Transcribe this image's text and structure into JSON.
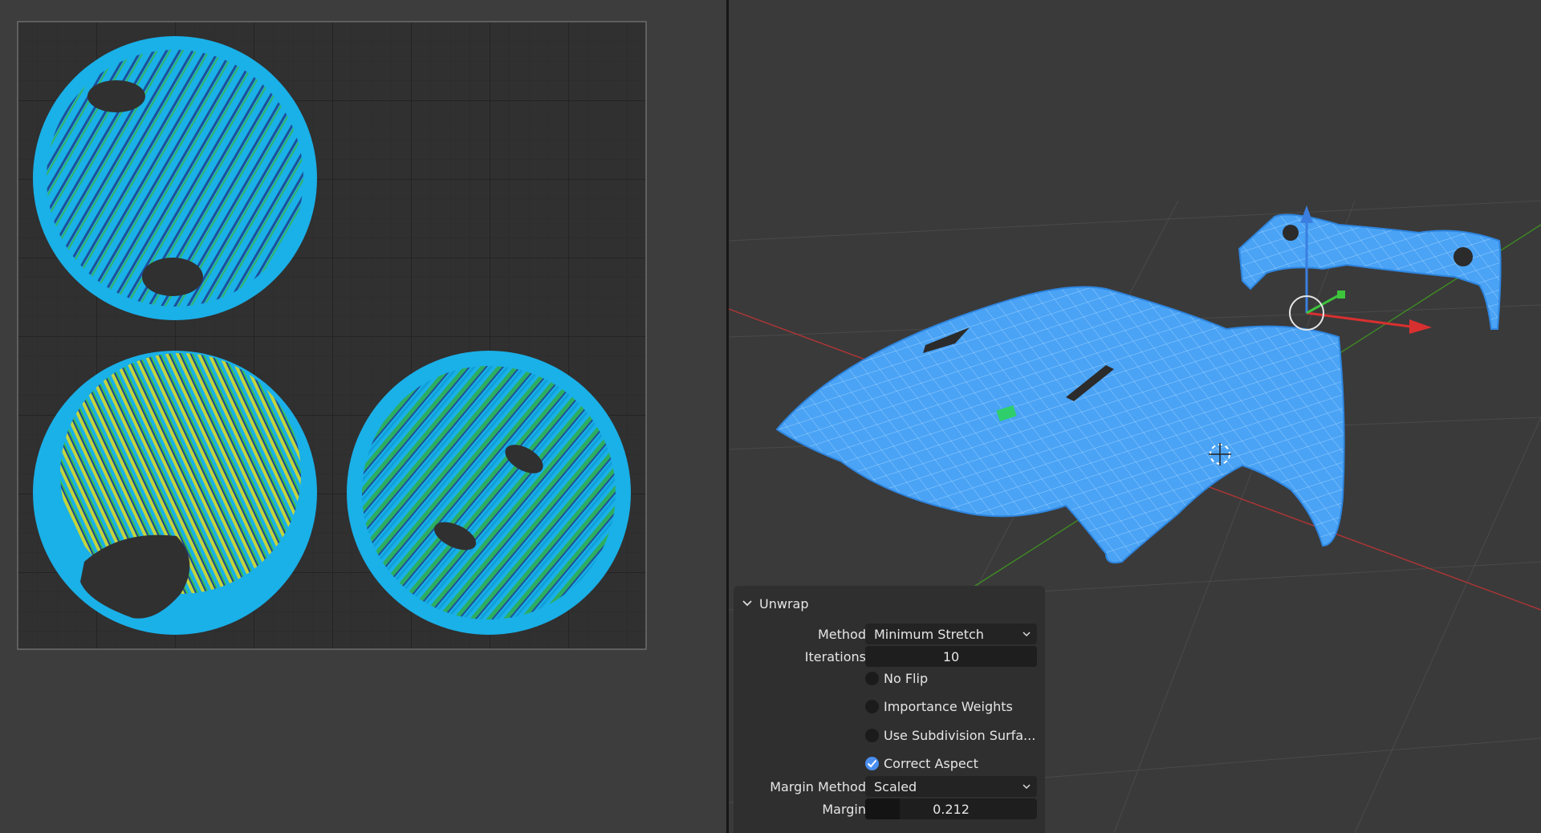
{
  "uv_editor": {
    "islands": [
      {
        "name": "uv-island-top-left"
      },
      {
        "name": "uv-island-bottom-left"
      },
      {
        "name": "uv-island-bottom-right"
      }
    ]
  },
  "viewport": {
    "mesh": "car body parts (hood, fender, rear bumper) with UV stretch overlay",
    "colors": {
      "mesh": "#4aa3f5",
      "x_axis": "#c83232",
      "y_axis": "#4a9a2a",
      "z_axis": "#3a7fe0"
    }
  },
  "operator_panel": {
    "title": "Unwrap",
    "method": {
      "label": "Method",
      "value": "Minimum Stretch"
    },
    "iterations": {
      "label": "Iterations",
      "value": "10"
    },
    "no_flip": {
      "label": "No Flip",
      "checked": false
    },
    "importance_weights": {
      "label": "Importance Weights",
      "checked": false
    },
    "use_subdivision": {
      "label": "Use Subdivision Surfa...",
      "checked": false
    },
    "correct_aspect": {
      "label": "Correct Aspect",
      "checked": true
    },
    "margin_method": {
      "label": "Margin Method",
      "value": "Scaled"
    },
    "margin": {
      "label": "Margin",
      "value": "0.212"
    }
  },
  "colors": {
    "accent": "#4a8ef0",
    "uv_fill": "#1ab0e8",
    "stretch_low": "#1e6fd9",
    "stretch_mid": "#3fbf3a",
    "stretch_high": "#e8e020"
  }
}
